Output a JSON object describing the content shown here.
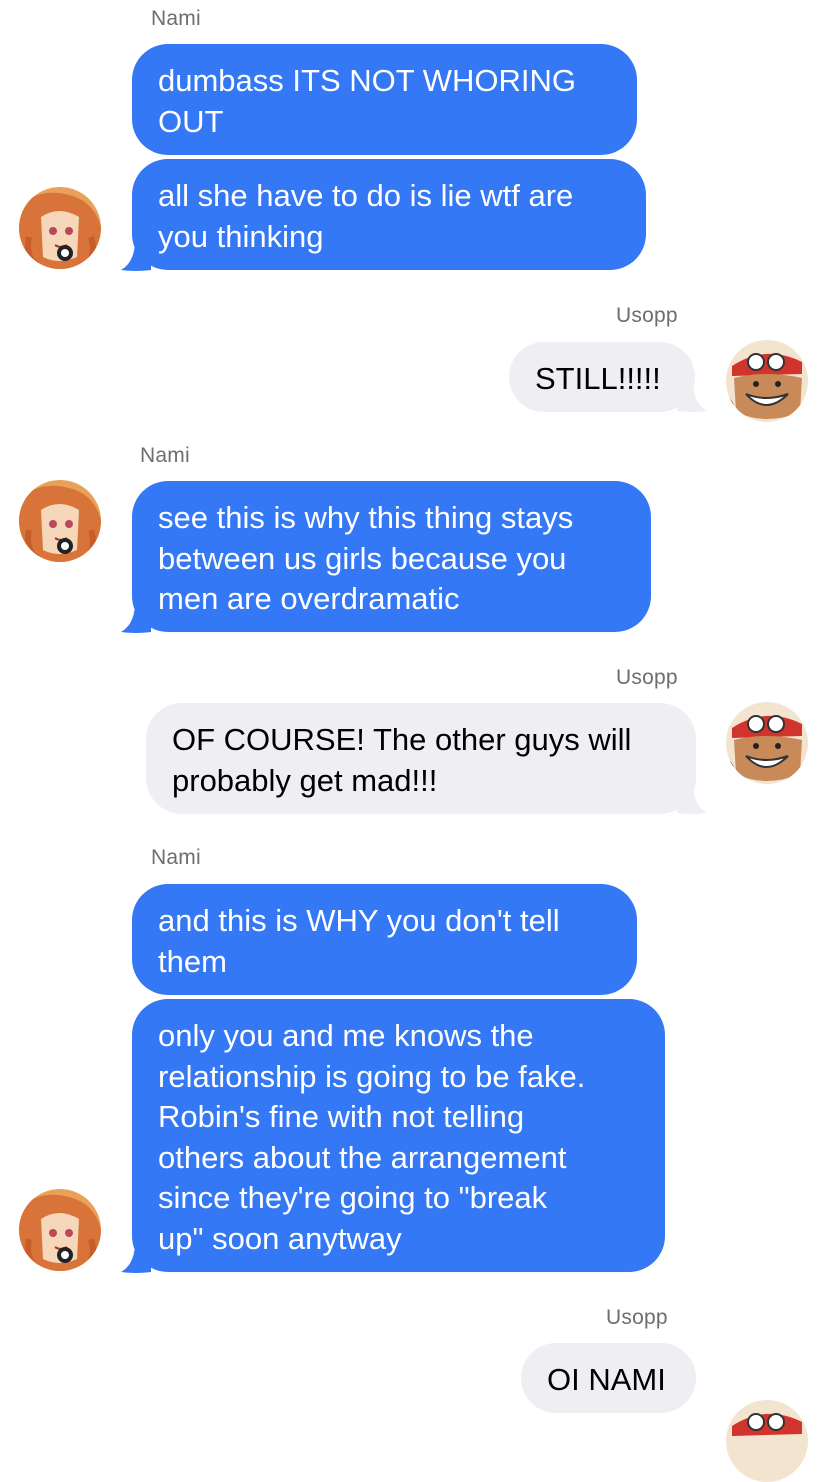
{
  "conversation": {
    "messages": [
      {
        "sender": "Nami",
        "text": "dumbass ITS NOT WHORING\nOUT"
      },
      {
        "text": "all she have to do is lie wtf are\nyou thinking"
      },
      {
        "sender": "Usopp",
        "text": "STILL!!!!!"
      },
      {
        "sender": "Nami",
        "text": "see this is why this thing stays\nbetween us girls because you\nmen are overdramatic"
      },
      {
        "sender": "Usopp",
        "text": "OF COURSE! The other guys will\nprobably get mad!!!"
      },
      {
        "sender": "Nami",
        "text": "and this is WHY you don't tell\nthem"
      },
      {
        "text": "only you and me knows the\nrelationship is going to be fake.\nRobin's fine with not telling\nothers about the arrangement\nsince they're going to \"break\nup\" soon anytway"
      },
      {
        "sender": "Usopp",
        "text": "OI NAMI"
      }
    ]
  },
  "colors": {
    "incoming_bubble": "#3478f6",
    "outgoing_bubble": "#efeff3",
    "sender_label": "#6d6d72"
  },
  "avatars": {
    "nami": "nami-avatar",
    "usopp": "usopp-avatar"
  }
}
